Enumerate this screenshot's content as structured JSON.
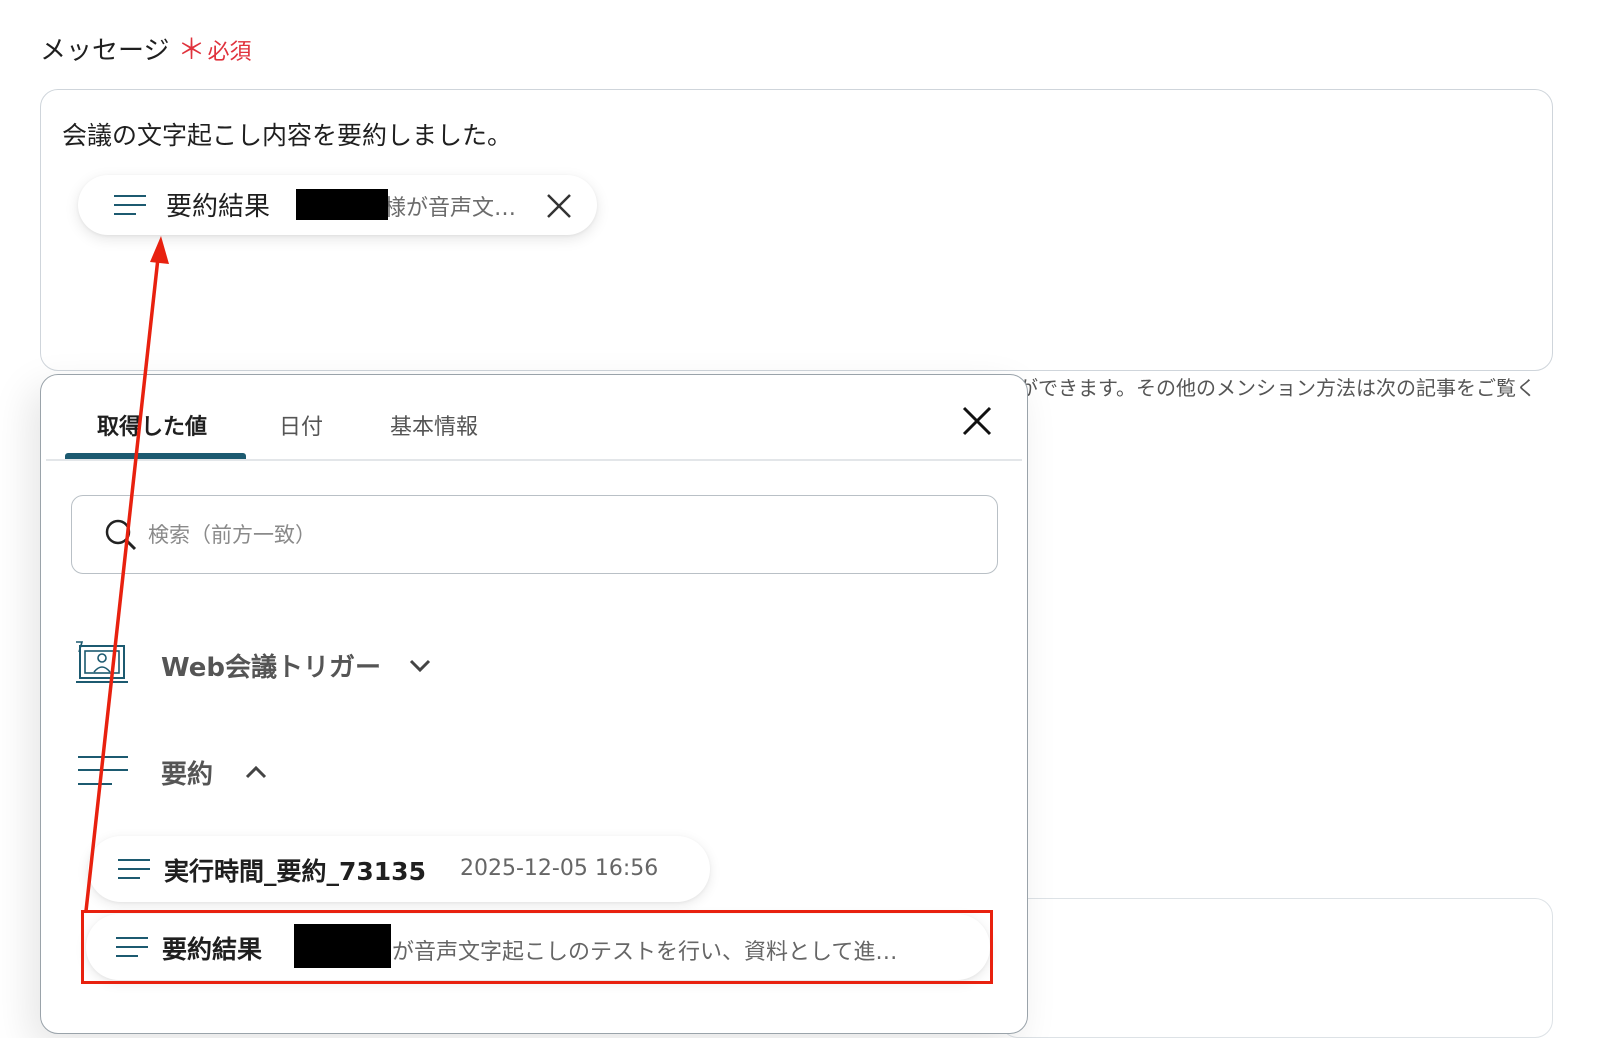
{
  "field": {
    "label": "メッセージ",
    "required_mark": "＊",
    "required_text": "必須"
  },
  "message": {
    "text": "会議の文字起こし内容を要約しました。",
    "chip": {
      "label": "要約結果",
      "value": "様が音声文…",
      "icon": "lines-icon",
      "close_icon": "close-icon"
    }
  },
  "helper_text": "ができます。その他のメンション方法は次の記事をご覧く",
  "popover": {
    "tabs": [
      {
        "label": "取得した値",
        "active": true
      },
      {
        "label": "日付",
        "active": false
      },
      {
        "label": "基本情報",
        "active": false
      }
    ],
    "search": {
      "placeholder": "検索（前方一致）",
      "value": "",
      "icon": "search-icon"
    },
    "sections": [
      {
        "title": "Web会議トリガー",
        "icon": "web-meeting-icon",
        "expanded": false
      },
      {
        "title": "要約",
        "icon": "lines-icon",
        "expanded": true
      }
    ],
    "items": [
      {
        "label": "実行時間_要約_73135",
        "value": "2025-12-05 16:56"
      },
      {
        "label": "要約結果",
        "value": "が音声文字起こしのテストを行い、資料として進…",
        "redacted_prefix": true
      }
    ]
  },
  "colors": {
    "accent": "#1c5a70",
    "required": "#e0323c",
    "annotation": "#e8210f"
  }
}
